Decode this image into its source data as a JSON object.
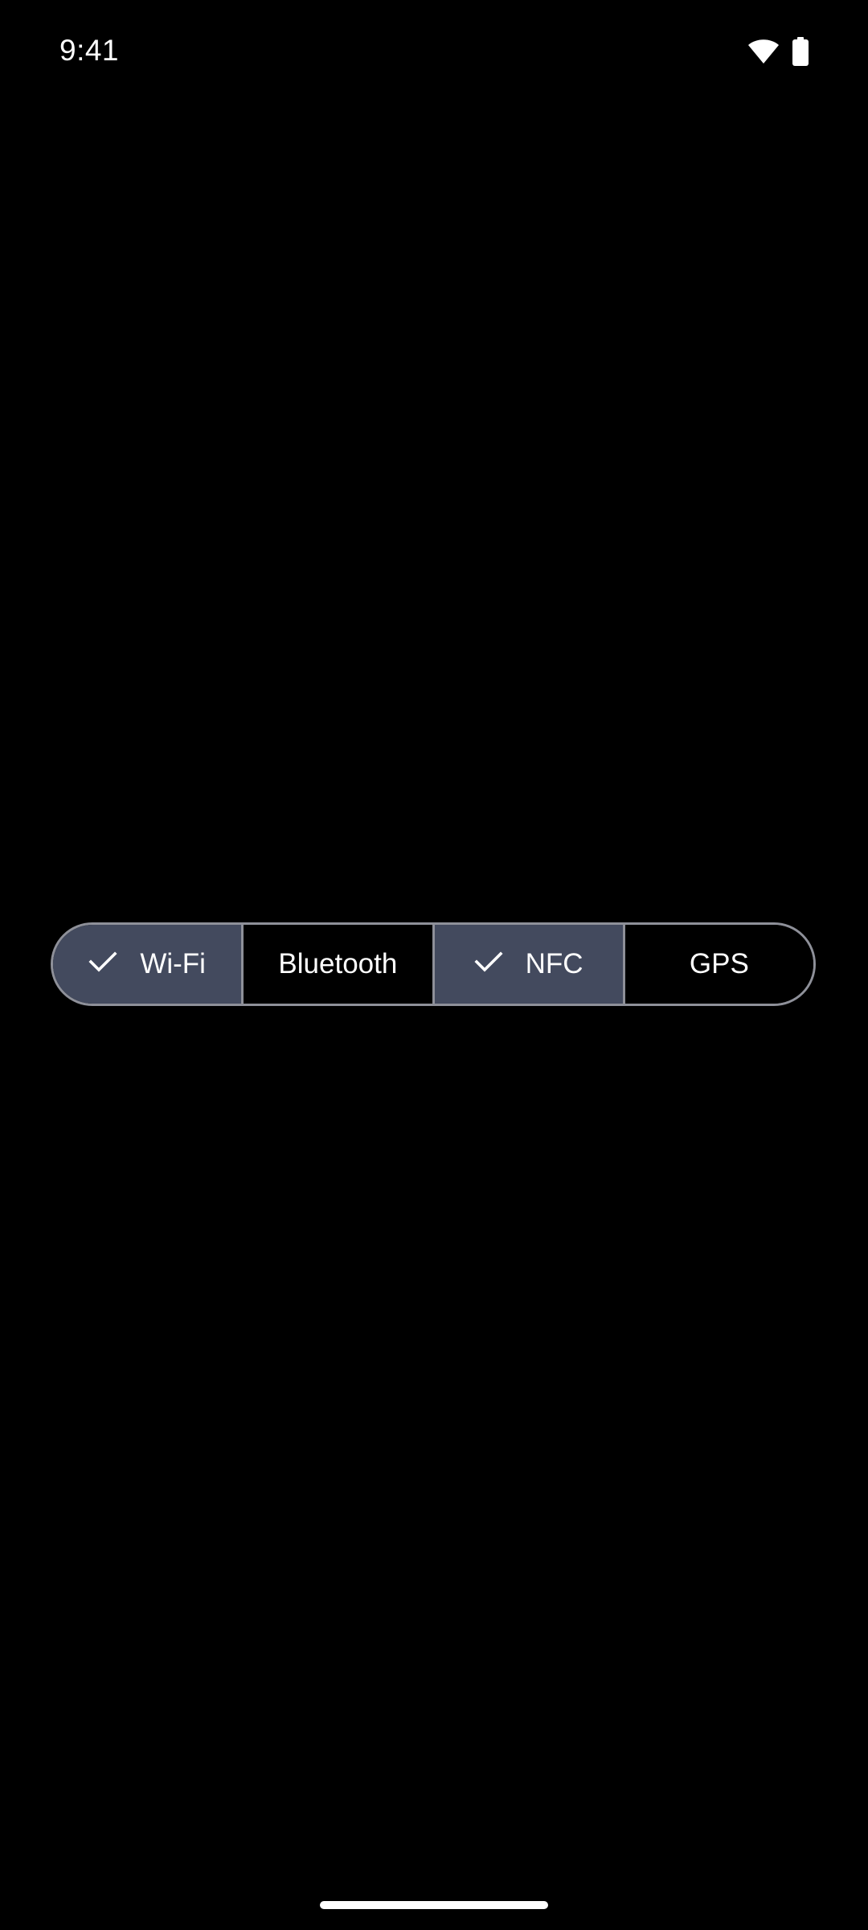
{
  "status_bar": {
    "time": "9:41",
    "icons": [
      "wifi-icon",
      "battery-icon"
    ]
  },
  "segmented_button": {
    "segments": [
      {
        "label": "Wi-Fi",
        "selected": true
      },
      {
        "label": "Bluetooth",
        "selected": false
      },
      {
        "label": "NFC",
        "selected": true
      },
      {
        "label": "GPS",
        "selected": false
      }
    ],
    "selected_icon": "check-icon",
    "colors": {
      "selected_background": "#434a5e",
      "unselected_background": "#000000",
      "outline": "#8e9099",
      "text": "#ffffff"
    }
  }
}
